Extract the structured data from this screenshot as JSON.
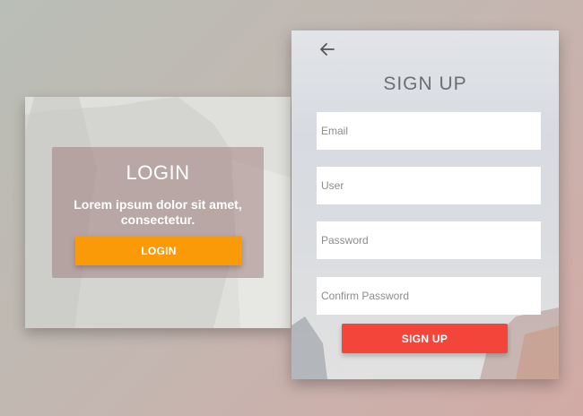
{
  "login": {
    "title": "LOGIN",
    "text": "Lorem ipsum dolor sit amet, consectetur.",
    "button_label": "LOGIN"
  },
  "signup": {
    "back_icon": "arrow-left-icon",
    "title": "SIGN UP",
    "fields": {
      "email_placeholder": "Email",
      "user_placeholder": "User",
      "password_placeholder": "Password",
      "confirm_placeholder": "Confirm Password"
    },
    "button_label": "SIGN UP"
  },
  "colors": {
    "login_button": "#fb9a08",
    "signup_button": "#f3453a",
    "title_text": "#6b6e72"
  }
}
